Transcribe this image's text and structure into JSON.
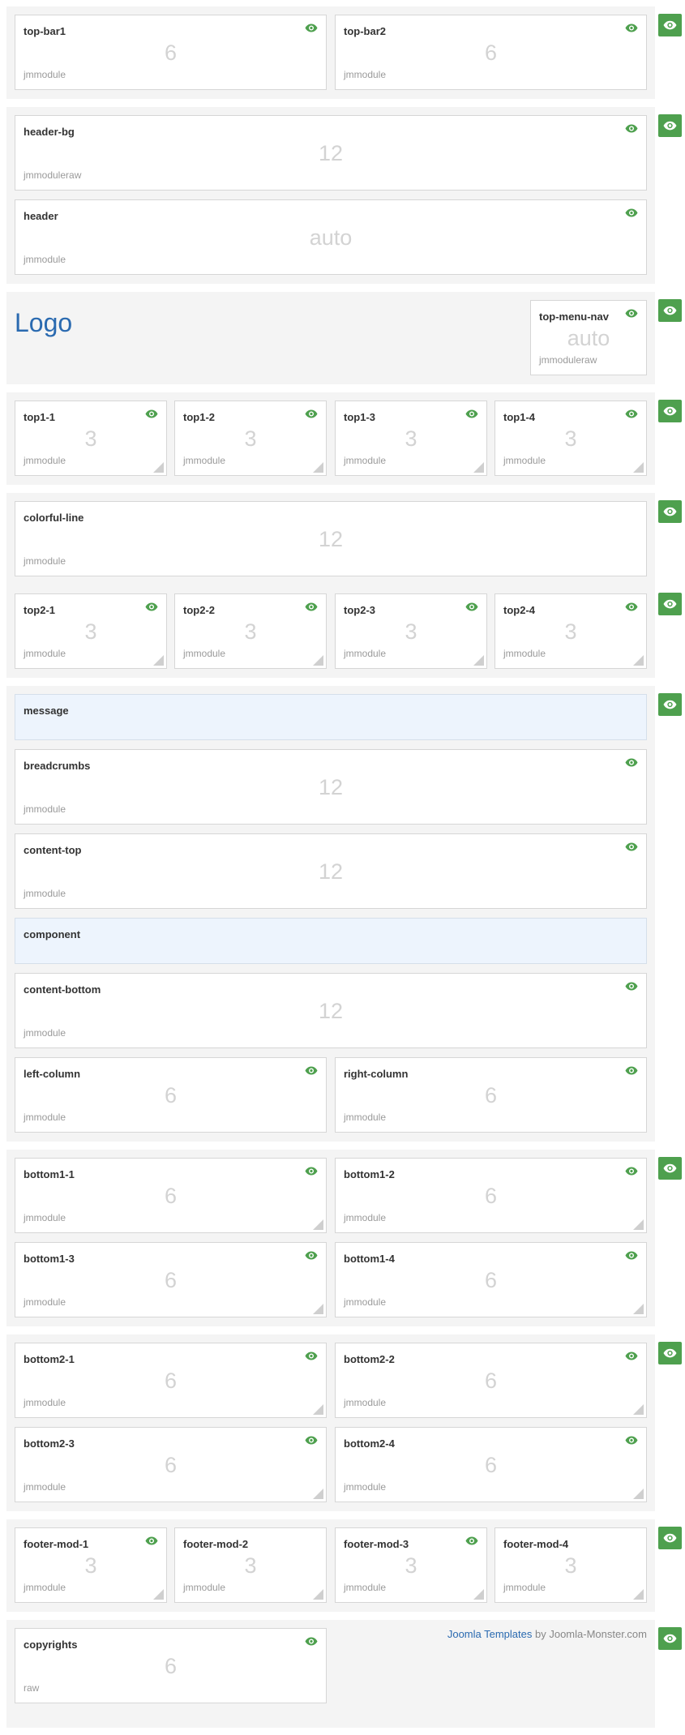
{
  "colors": {
    "eye": "#4ea04e",
    "toggle": "#4ea04e",
    "logo": "#2a6ab0",
    "message_bg": "#edf4fd"
  },
  "icons": {
    "visibility": "eye-icon",
    "resize": "resize-handle-icon"
  },
  "header": {
    "logo": "Logo"
  },
  "rows": {
    "top_bar": [
      {
        "name": "top-bar1",
        "span": "6",
        "type": "jmmodule"
      },
      {
        "name": "top-bar2",
        "span": "6",
        "type": "jmmodule"
      }
    ],
    "header_bg": {
      "name": "header-bg",
      "span": "12",
      "type": "jmmoduleraw"
    },
    "header": {
      "name": "header",
      "span": "auto",
      "type": "jmmodule"
    },
    "top_menu": {
      "name": "top-menu-nav",
      "span": "auto",
      "type": "jmmoduleraw"
    },
    "top1": [
      {
        "name": "top1-1",
        "span": "3",
        "type": "jmmodule"
      },
      {
        "name": "top1-2",
        "span": "3",
        "type": "jmmodule"
      },
      {
        "name": "top1-3",
        "span": "3",
        "type": "jmmodule"
      },
      {
        "name": "top1-4",
        "span": "3",
        "type": "jmmodule"
      }
    ],
    "colorful": {
      "name": "colorful-line",
      "span": "12",
      "type": "jmmodule"
    },
    "top2": [
      {
        "name": "top2-1",
        "span": "3",
        "type": "jmmodule"
      },
      {
        "name": "top2-2",
        "span": "3",
        "type": "jmmodule"
      },
      {
        "name": "top2-3",
        "span": "3",
        "type": "jmmodule"
      },
      {
        "name": "top2-4",
        "span": "3",
        "type": "jmmodule"
      }
    ],
    "message": {
      "name": "message"
    },
    "breadcrumbs": {
      "name": "breadcrumbs",
      "span": "12",
      "type": "jmmodule"
    },
    "content_top": {
      "name": "content-top",
      "span": "12",
      "type": "jmmodule"
    },
    "component": {
      "name": "component"
    },
    "content_bottom": {
      "name": "content-bottom",
      "span": "12",
      "type": "jmmodule"
    },
    "columns": [
      {
        "name": "left-column",
        "span": "6",
        "type": "jmmodule"
      },
      {
        "name": "right-column",
        "span": "6",
        "type": "jmmodule"
      }
    ],
    "bottom1": [
      {
        "name": "bottom1-1",
        "span": "6",
        "type": "jmmodule"
      },
      {
        "name": "bottom1-2",
        "span": "6",
        "type": "jmmodule"
      },
      {
        "name": "bottom1-3",
        "span": "6",
        "type": "jmmodule"
      },
      {
        "name": "bottom1-4",
        "span": "6",
        "type": "jmmodule"
      }
    ],
    "bottom2": [
      {
        "name": "bottom2-1",
        "span": "6",
        "type": "jmmodule"
      },
      {
        "name": "bottom2-2",
        "span": "6",
        "type": "jmmodule"
      },
      {
        "name": "bottom2-3",
        "span": "6",
        "type": "jmmodule"
      },
      {
        "name": "bottom2-4",
        "span": "6",
        "type": "jmmodule"
      }
    ],
    "footer": [
      {
        "name": "footer-mod-1",
        "span": "3",
        "type": "jmmodule"
      },
      {
        "name": "footer-mod-2",
        "span": "3",
        "type": "jmmodule"
      },
      {
        "name": "footer-mod-3",
        "span": "3",
        "type": "jmmodule"
      },
      {
        "name": "footer-mod-4",
        "span": "3",
        "type": "jmmodule"
      }
    ],
    "copyrights": {
      "name": "copyrights",
      "span": "6",
      "type": "raw"
    }
  },
  "credits": {
    "link": "Joomla Templates",
    "by": " by Joomla-Monster.com"
  }
}
